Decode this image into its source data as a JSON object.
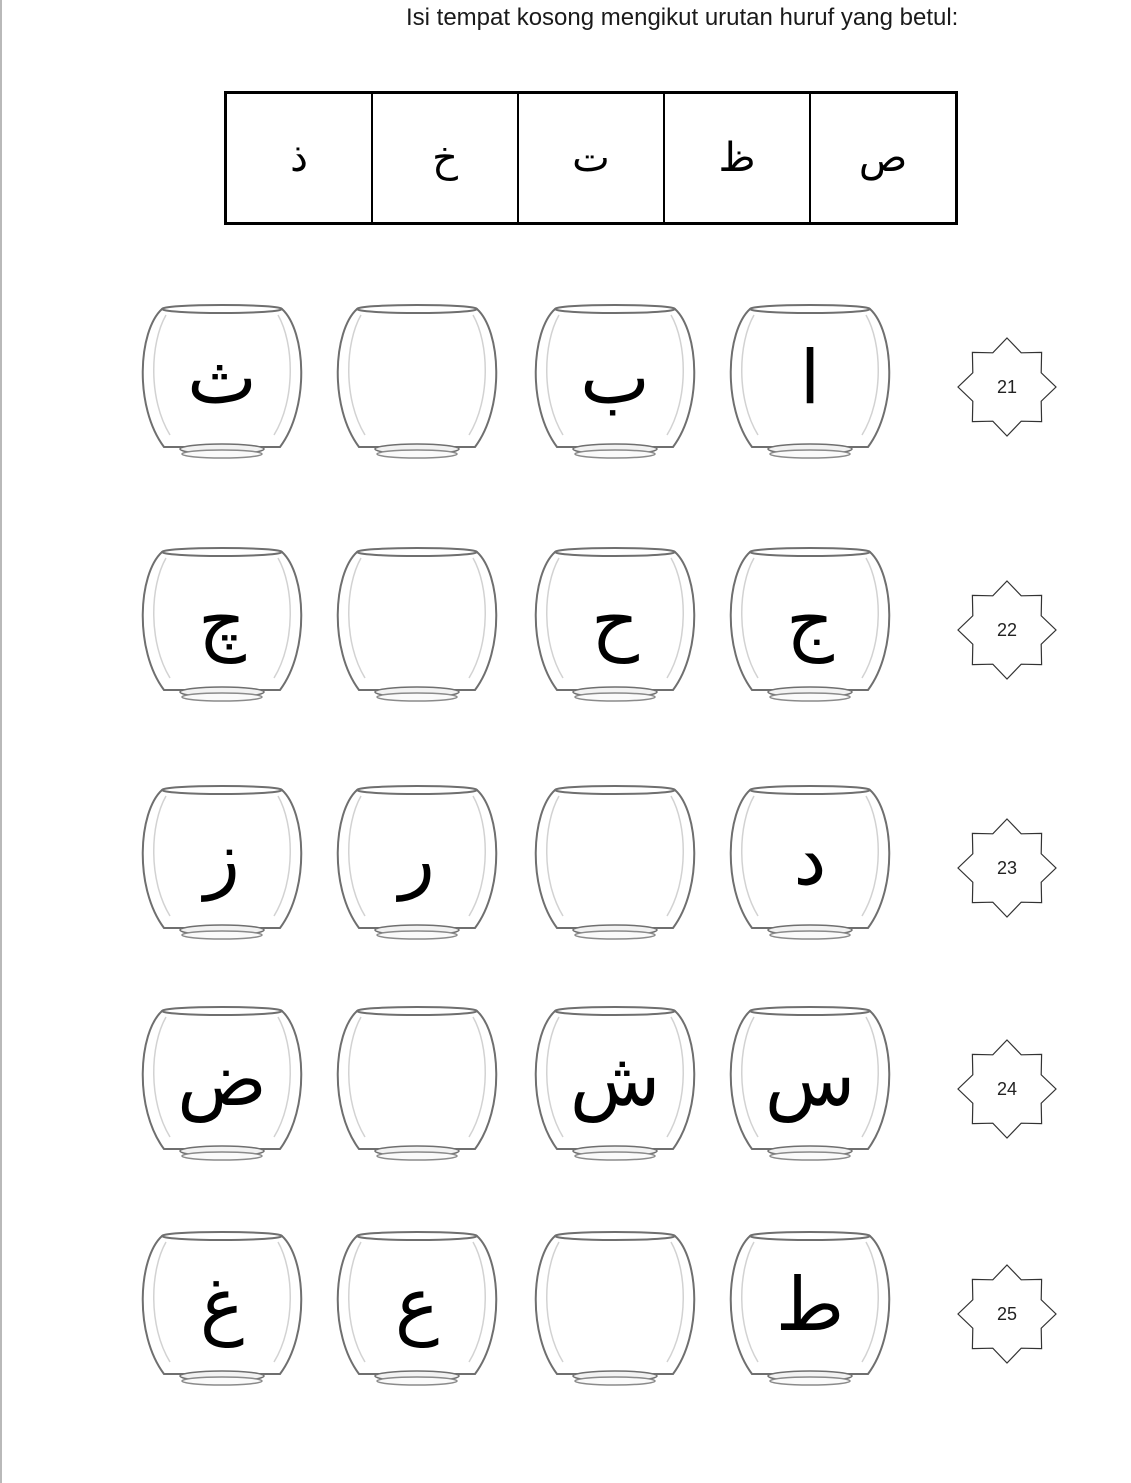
{
  "instruction": "Isi tempat kosong mengikut urutan huruf yang betul:",
  "letter_bank": [
    "ذ",
    "خ",
    "ت",
    "ظ",
    "ص"
  ],
  "rows": [
    {
      "number": "21",
      "bowls": [
        "ث",
        "",
        "ب",
        "ا"
      ]
    },
    {
      "number": "22",
      "bowls": [
        "چ",
        "",
        "ح",
        "ج"
      ]
    },
    {
      "number": "23",
      "bowls": [
        "ز",
        "ر",
        "",
        "د"
      ]
    },
    {
      "number": "24",
      "bowls": [
        "ض",
        "",
        "ش",
        "س"
      ]
    },
    {
      "number": "25",
      "bowls": [
        "غ",
        "ع",
        "",
        "ط"
      ]
    }
  ]
}
